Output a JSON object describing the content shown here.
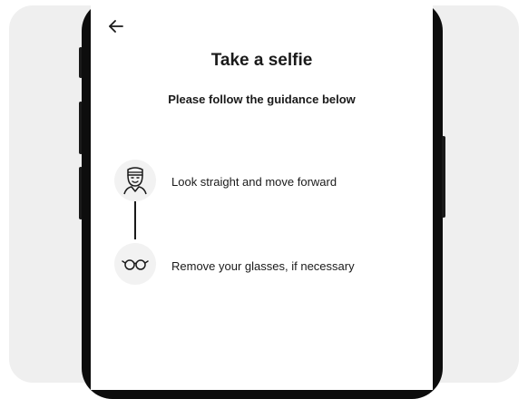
{
  "header": {
    "back_icon": "arrow-left-icon",
    "title": "Take a selfie",
    "subtitle": "Please follow the guidance below"
  },
  "steps": [
    {
      "icon": "face-icon",
      "text": "Look straight and move forward"
    },
    {
      "icon": "glasses-icon",
      "text": "Remove your glasses, if necessary"
    }
  ],
  "colors": {
    "background": "#efefef",
    "frame": "#0d0d0d",
    "screen": "#ffffff",
    "text": "#1a1a1a",
    "icon_bg": "#f2f2f2"
  }
}
